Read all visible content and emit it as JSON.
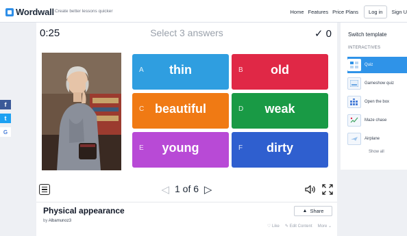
{
  "header": {
    "brand": "Wordwall",
    "tagline": "Create better lessons quicker",
    "nav": [
      "Home",
      "Features",
      "Price Plans"
    ],
    "login_label": "Log in",
    "signup_label": "Sign U"
  },
  "game": {
    "timer": "0:25",
    "prompt": "Select 3 answers",
    "score": "✓ 0",
    "answers": [
      {
        "letter": "A",
        "word": "thin",
        "color": "#2f9ee0"
      },
      {
        "letter": "B",
        "word": "old",
        "color": "#e02846"
      },
      {
        "letter": "C",
        "word": "beautiful",
        "color": "#f07a14"
      },
      {
        "letter": "D",
        "word": "weak",
        "color": "#199a45"
      },
      {
        "letter": "E",
        "word": "young",
        "color": "#b84ad6"
      },
      {
        "letter": "F",
        "word": "dirty",
        "color": "#2f5fcf"
      }
    ],
    "pager": "1 of 6",
    "prev_icon": "triangle-left-icon",
    "next_icon": "triangle-right-icon"
  },
  "activity": {
    "title": "Physical appearance",
    "by_label": "by",
    "author": "Albamunoz3",
    "share_label": "Share",
    "actions": [
      "♡ Like",
      "✎ Edit Content",
      "More ⌄"
    ]
  },
  "templates": {
    "title": "Switch template",
    "subtitle": "INTERACTIVES",
    "items": [
      {
        "name": "Quiz",
        "active": true
      },
      {
        "name": "Gameshow quiz",
        "active": false
      },
      {
        "name": "Open the box",
        "active": false
      },
      {
        "name": "Maze chase",
        "active": false
      },
      {
        "name": "Airplane",
        "active": false
      }
    ],
    "show_all": "Show all"
  },
  "left_share": [
    {
      "glyph": "f",
      "color": "#3b5998"
    },
    {
      "glyph": "t",
      "color": "#1da1f2"
    },
    {
      "glyph": "G",
      "color": "#ffffff"
    }
  ]
}
